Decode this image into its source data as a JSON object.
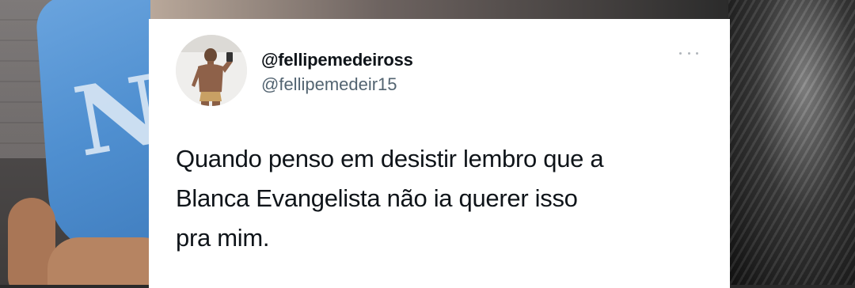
{
  "tweet": {
    "display_name": "@fellipemedeiross",
    "handle": "@fellipemedeir15",
    "text_lines": [
      "Quando penso em desistir lembro que a",
      "Blanca Evangelista não ia querer isso",
      "pra mim."
    ],
    "more_icon": "more-horizontal-icon"
  }
}
